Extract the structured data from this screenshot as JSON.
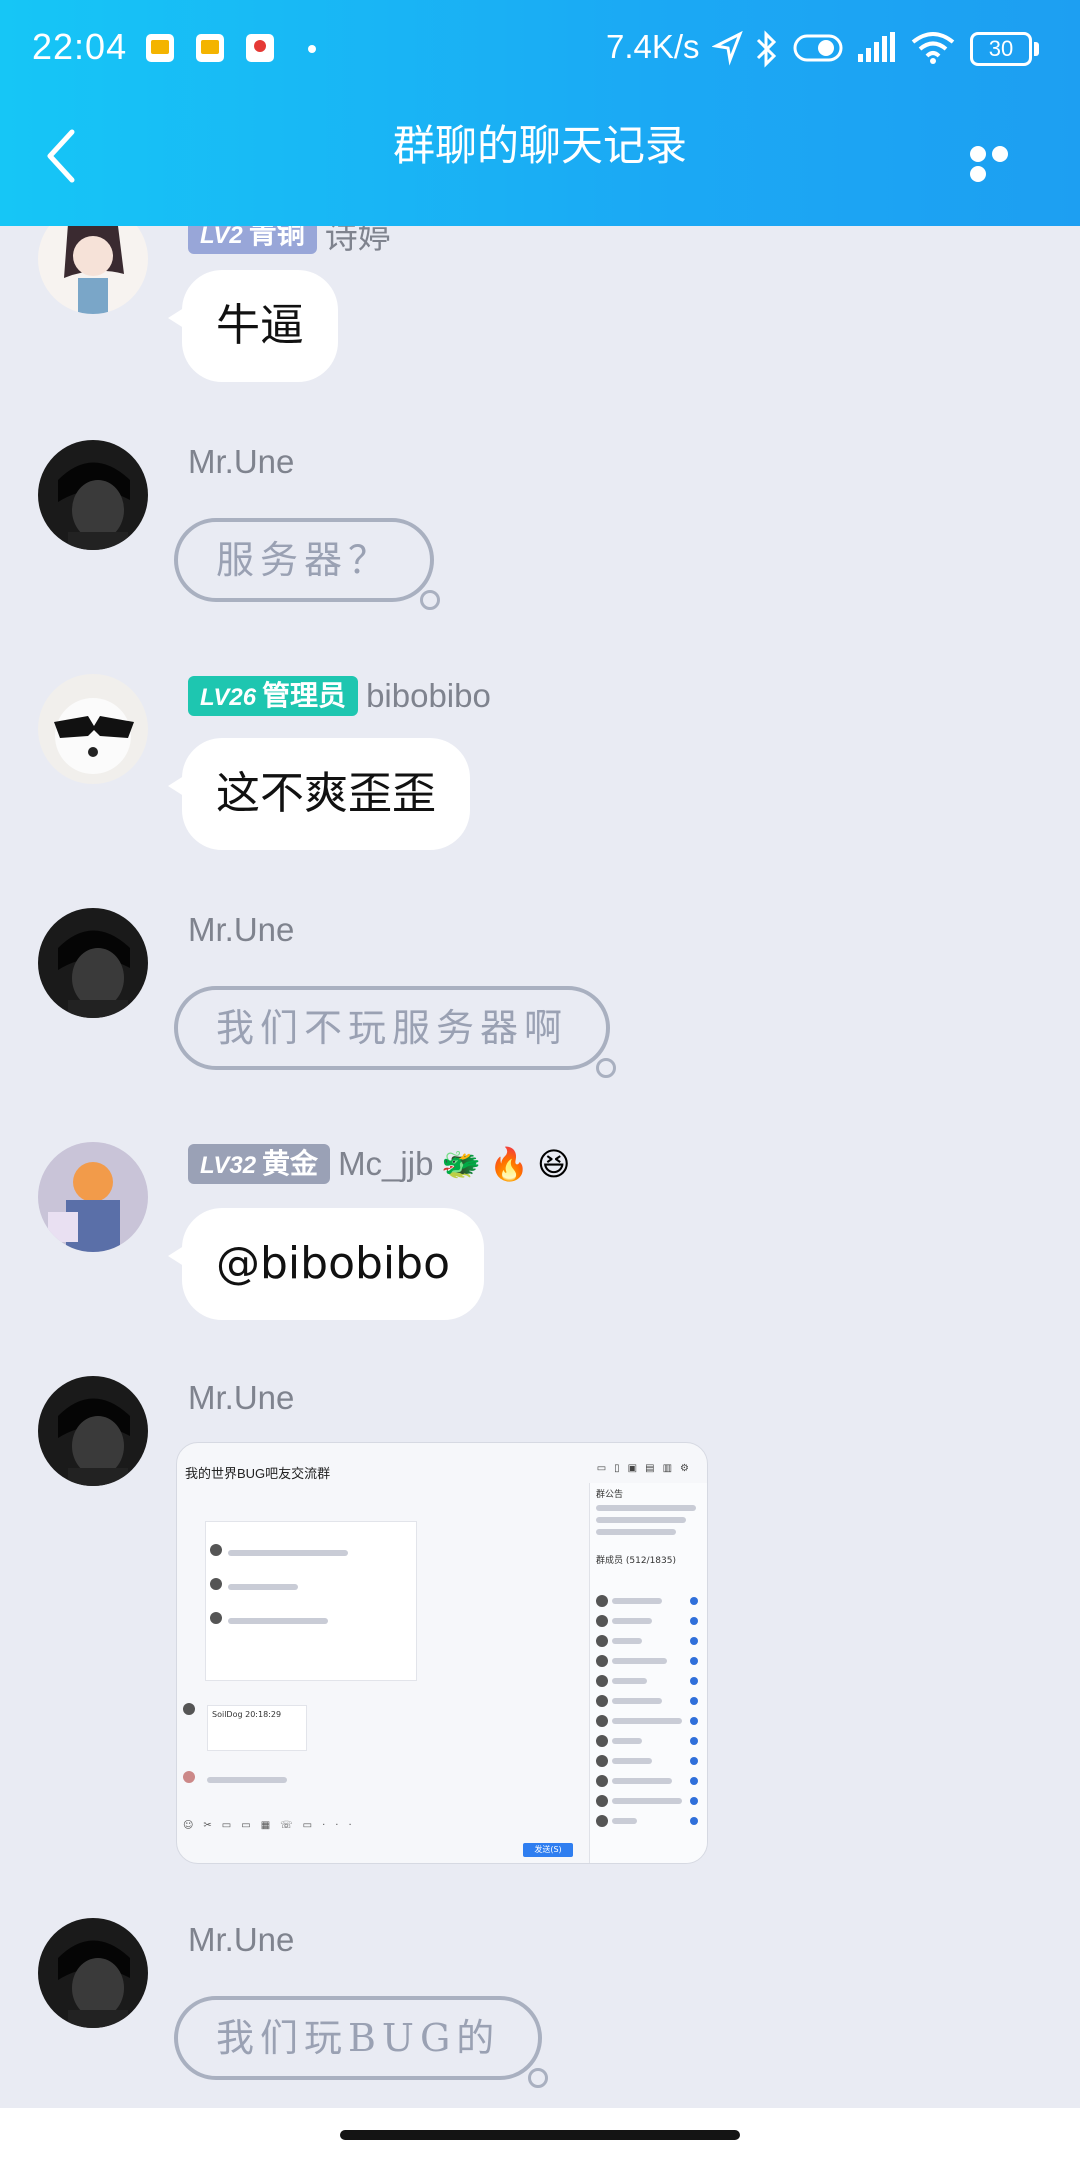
{
  "status_bar": {
    "time": "22:04",
    "net_speed": "7.4K/s",
    "battery": "30",
    "icons": [
      "app-notification-icon",
      "app-notification-icon",
      "map-app-icon",
      "location-arrow-icon",
      "bluetooth-icon",
      "toggle-icon",
      "signal-icon",
      "wifi-icon",
      "battery-icon"
    ]
  },
  "header": {
    "title": "群聊的聊天记录",
    "back_icon": "chevron-left-icon",
    "more_icon": "more-dots-icon"
  },
  "messages": [
    {
      "badge_level": "LV2",
      "badge_title": "青铜",
      "sender": "诗婷",
      "text": "牛逼",
      "style": "bubble"
    },
    {
      "sender": "Mr.Une",
      "text": "服务器？",
      "style": "sketch"
    },
    {
      "badge_level": "LV26",
      "badge_title": "管理员",
      "sender": "bibobibo",
      "text": "这不爽歪歪",
      "style": "bubble",
      "badge_color": "#1ec6b0"
    },
    {
      "sender": "Mr.Une",
      "text": "我们不玩服务器啊",
      "style": "sketch"
    },
    {
      "badge_level": "LV32",
      "badge_title": "黄金",
      "sender": "Mc_jjb",
      "emojis": [
        "🐲",
        "🔥",
        "😆"
      ],
      "text": "@bibobibo",
      "style": "bubble"
    },
    {
      "sender": "Mr.Une",
      "style": "image",
      "image": {
        "window_title": "我的世界BUG吧友交流群",
        "tabs": [
          "聊天",
          "公告",
          "相册",
          "文件",
          "应用",
          "设置"
        ],
        "member_count": "群成员 (512/1835)",
        "announcement": "群公告",
        "send_button": "发送(S)",
        "quote_user": "SoilDog",
        "quote_time": "20:18:29"
      }
    },
    {
      "sender": "Mr.Une",
      "text": "我们玩BUG的",
      "style": "sketch"
    }
  ],
  "colors": {
    "header_start": "#16c6f6",
    "header_end": "#1d9ff2",
    "background": "#e9ebf3",
    "admin_badge": "#1ec6b0",
    "gold_badge": "#9aa1b6",
    "bronze_badge": "#98a6d8"
  }
}
